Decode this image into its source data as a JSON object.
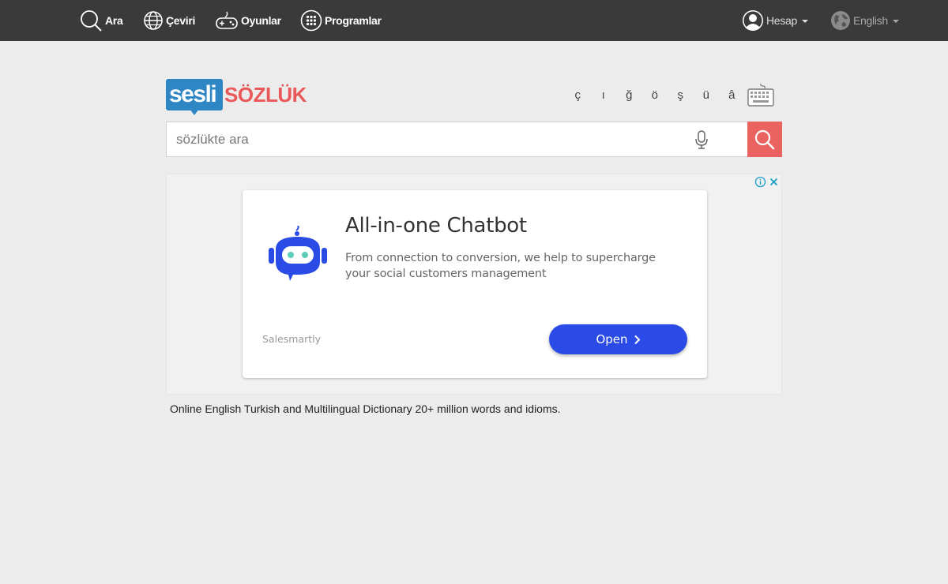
{
  "nav": {
    "items": [
      {
        "label": "Ara",
        "icon": "search-icon"
      },
      {
        "label": "Çeviri",
        "icon": "globe-icon"
      },
      {
        "label": "Oyunlar",
        "icon": "gamepad-icon"
      },
      {
        "label": "Programlar",
        "icon": "apps-grid-icon"
      }
    ],
    "account_label": "Hesap",
    "language_label": "English"
  },
  "logo": {
    "part1": "sesli",
    "part2": "SÖZLÜK"
  },
  "special_chars": [
    "ç",
    "ı",
    "ğ",
    "ö",
    "ş",
    "ü",
    "â"
  ],
  "search": {
    "placeholder": "sözlükte ara",
    "value": ""
  },
  "ad": {
    "title": "All-in-one Chatbot",
    "description": "From connection to conversion, we help to supercharge your social customers management",
    "brand": "Salesmartly",
    "cta": "Open"
  },
  "tagline": "Online English Turkish and Multilingual Dictionary 20+ million words and idioms.",
  "colors": {
    "topbar": "#3a3a3a",
    "brand_blue": "#2f86c5",
    "brand_red": "#e9595a",
    "search_button": "#ea6361",
    "ad_button": "#2a4be6"
  }
}
